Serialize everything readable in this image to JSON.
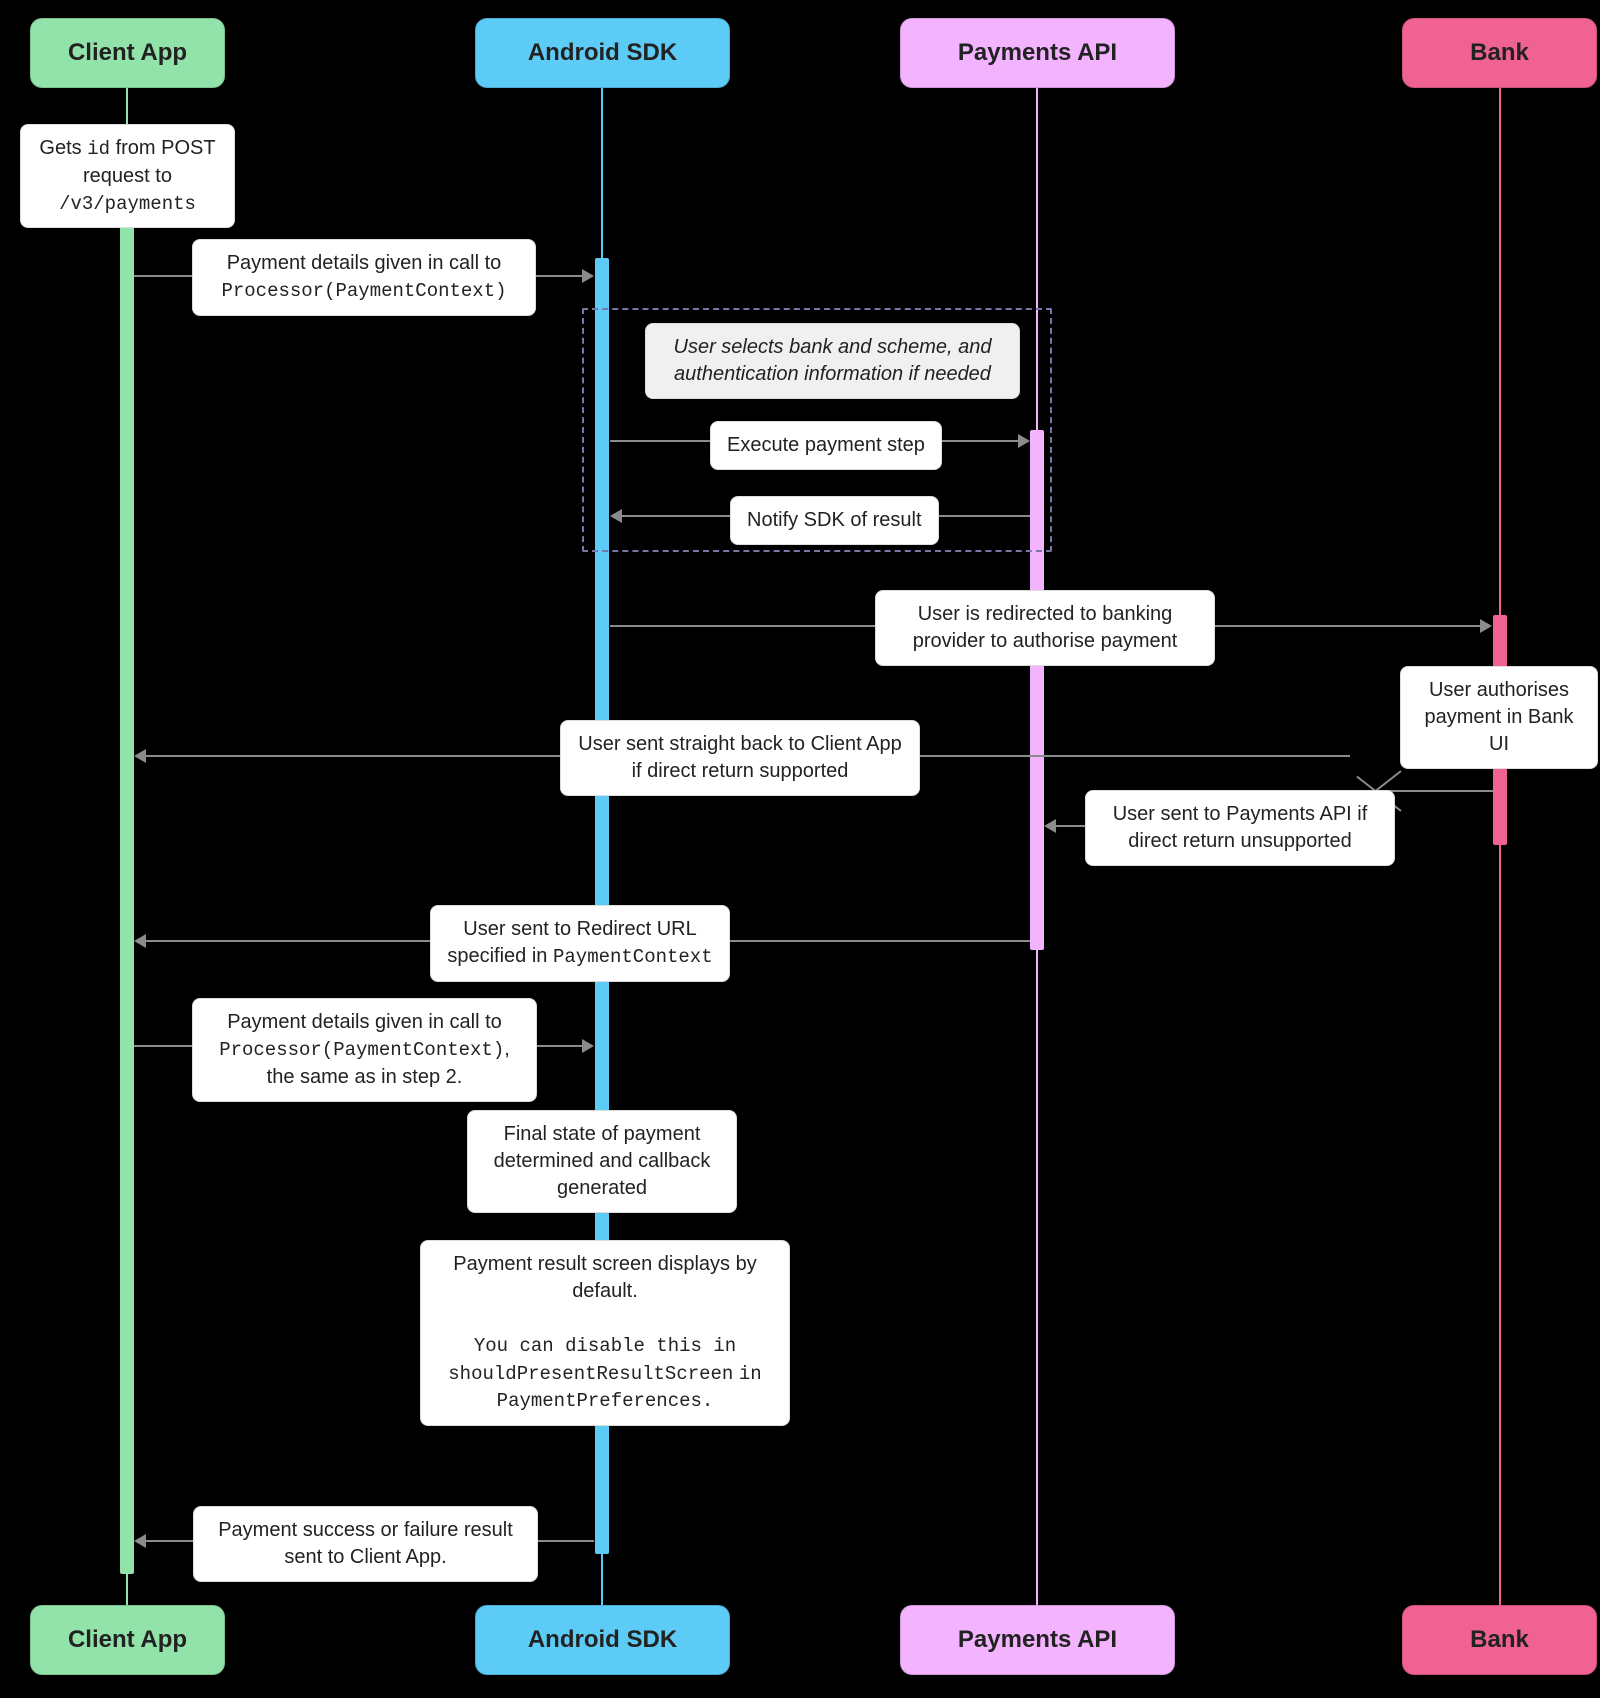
{
  "actors": {
    "client": "Client App",
    "sdk": "Android SDK",
    "api": "Payments API",
    "bank": "Bank"
  },
  "notes": {
    "getsId_pre": "Gets ",
    "getsId_code": "id",
    "getsId_mid": " from POST request to ",
    "getsId_path": "/v3/payments",
    "payDetails_pre": "Payment details given in call to ",
    "payDetails_code": "Processor(PaymentContext)",
    "loopNote": "User selects bank and scheme, and authentication information if needed",
    "exec": "Execute payment step",
    "notify": "Notify SDK of result",
    "redirectToBank": "User is redirected to banking provider to authorise payment",
    "authInBank": "User authorises payment in Bank UI",
    "directReturn": "User sent straight back to Client App if direct return supported",
    "toApi": "User sent to Payments API if direct return unsupported",
    "redirectUrl_pre": "User sent to Redirect URL specified in ",
    "redirectUrl_code": "PaymentContext",
    "payDetails2_pre": "Payment details given in call to ",
    "payDetails2_code": "Processor(PaymentContext)",
    "payDetails2_post": ", the same as in step 2.",
    "finalState": "Final state of payment determined and callback generated",
    "resultScreen_l1": "Payment result screen displays by default.",
    "resultScreen_l2a": "You can disable this in ",
    "resultScreen_code1": "shouldPresentResultScreen",
    "resultScreen_l2b": " in ",
    "resultScreen_code2": "PaymentPreferences",
    "resultScreen_l2c": ".",
    "finalMsg": "Payment success or failure result sent to Client App."
  },
  "positions": {
    "clientX": 127,
    "sdkX": 602,
    "apiX": 1037,
    "bankX": 1500
  }
}
